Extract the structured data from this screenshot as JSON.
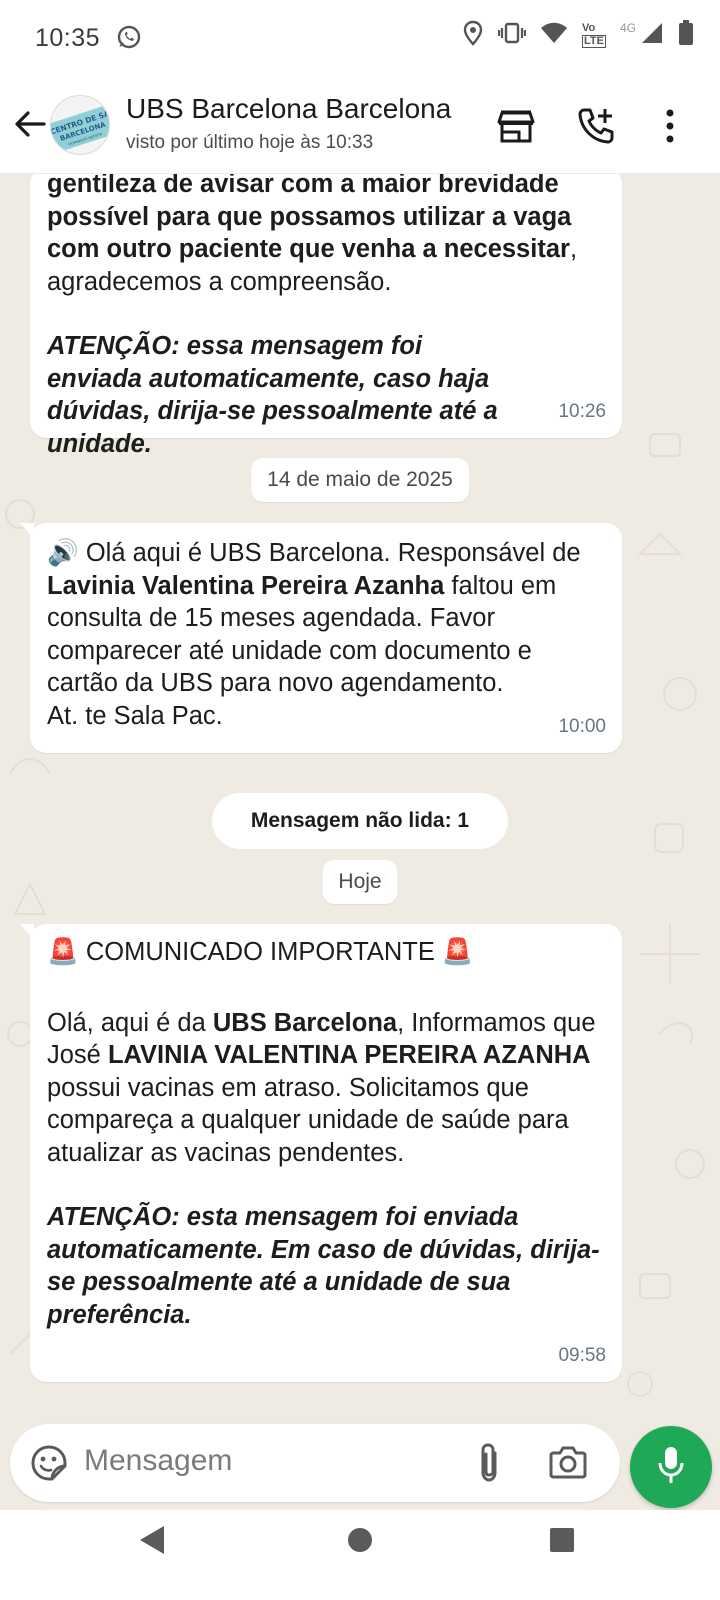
{
  "status_bar": {
    "time": "10:35",
    "network_badge_top": "Vo",
    "network_badge_bottom": "LTE",
    "network_type": "4G",
    "icons": [
      "whatsapp-icon",
      "location-icon",
      "vibrate-icon",
      "wifi-icon",
      "signal-icon",
      "battery-icon"
    ]
  },
  "header": {
    "contact_name": "UBS Barcelona Barcelona",
    "last_seen": "visto por último hoje às 10:33",
    "avatar_text_line1": "CENTRO DE SAÚDE",
    "avatar_text_line2": "BARCELONA",
    "icons": [
      "back-arrow-icon",
      "store-icon",
      "add-call-icon",
      "more-vert-icon"
    ]
  },
  "messages": [
    {
      "id": "msg1",
      "parts": {
        "bold1": "gentileza de avisar com a maior brevidade possível para que possamos utilizar a vaga com outro paciente que venha a necessitar",
        "normal1": ", agradecemos a compreensão.",
        "warning": "ATENÇÃO: essa mensagem foi enviada automaticamente, caso haja dúvidas, dirija-se pessoalmente até a unidade."
      },
      "time": "10:26"
    },
    {
      "id": "msg2",
      "parts": {
        "emoji": "🔊",
        "text1": " Olá aqui é UBS Barcelona. Responsável de ",
        "bold_name": "Lavinia Valentina Pereira Azanha",
        "text2": " faltou em consulta de 15 meses agendada. Favor comparecer até unidade com documento  e cartão da UBS para novo agendamento.",
        "text3": "At. te Sala Pac."
      },
      "time": "10:00"
    },
    {
      "id": "msg3",
      "parts": {
        "title_emoji": "🚨",
        "title": " COMUNICADO IMPORTANTE ",
        "text1": "Olá, aqui é da ",
        "bold_ubs": "UBS Barcelona",
        "text2": ", Informamos que José ",
        "bold_name": "LAVINIA VALENTINA PEREIRA AZANHA",
        "text3": " possui vacinas em atraso. Solicitamos que compareça a qualquer unidade de saúde para atualizar as vacinas pendentes.",
        "warning": "ATENÇÃO: esta mensagem foi enviada automaticamente. Em caso de dúvidas, dirija-se pessoalmente até a unidade de sua preferência."
      },
      "time": "09:58"
    }
  ],
  "chips": {
    "date1": "14 de maio de 2025",
    "unread": "Mensagem não lida: 1",
    "today": "Hoje"
  },
  "composer": {
    "placeholder": "Mensagem",
    "icons": [
      "sticker-icon",
      "attach-icon",
      "camera-icon",
      "mic-icon"
    ]
  },
  "nav": {
    "icons": [
      "back-triangle-icon",
      "home-circle-icon",
      "recents-square-icon"
    ]
  },
  "colors": {
    "chat_bg": "#efeae2",
    "accent_green": "#1fa855",
    "bubble": "#ffffff",
    "meta_text": "#667781"
  }
}
